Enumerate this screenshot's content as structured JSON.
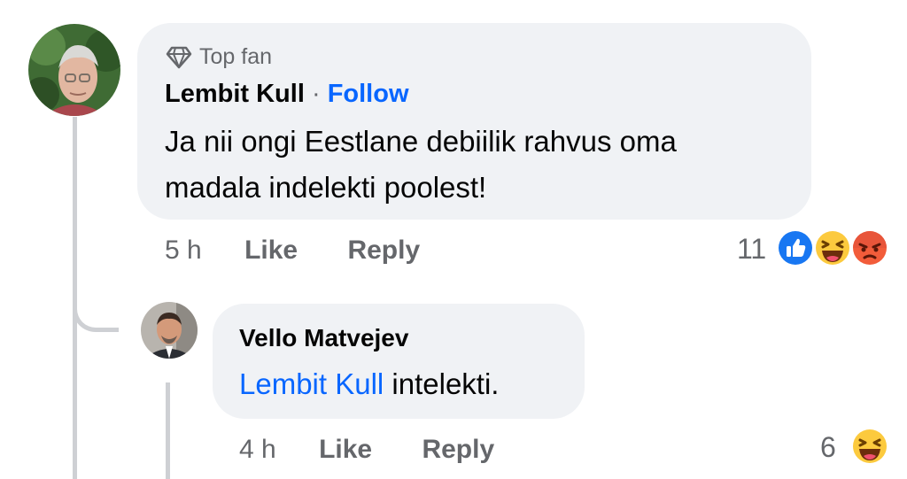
{
  "comments": [
    {
      "badge": "Top fan",
      "author": "Lembit Kull",
      "separator": "·",
      "follow_label": "Follow",
      "text_line1": "Ja nii ongi Eestlane debiilik rahvus oma",
      "text_line2": "madala indelekti poolest!",
      "time": "5 h",
      "like_label": "Like",
      "reply_label": "Reply",
      "reaction_count": "11",
      "reactions": [
        "like-icon",
        "haha-icon",
        "angry-icon"
      ]
    },
    {
      "author": "Vello Matvejev",
      "mention": "Lembit Kull",
      "text": " intelekti.",
      "time": "4 h",
      "like_label": "Like",
      "reply_label": "Reply",
      "reaction_count": "6",
      "reactions": [
        "haha-icon"
      ]
    }
  ],
  "colors": {
    "link_blue": "#0866ff",
    "bubble_bg": "#f0f2f5",
    "meta_gray": "#65676b",
    "thread_line": "#ced0d4"
  }
}
